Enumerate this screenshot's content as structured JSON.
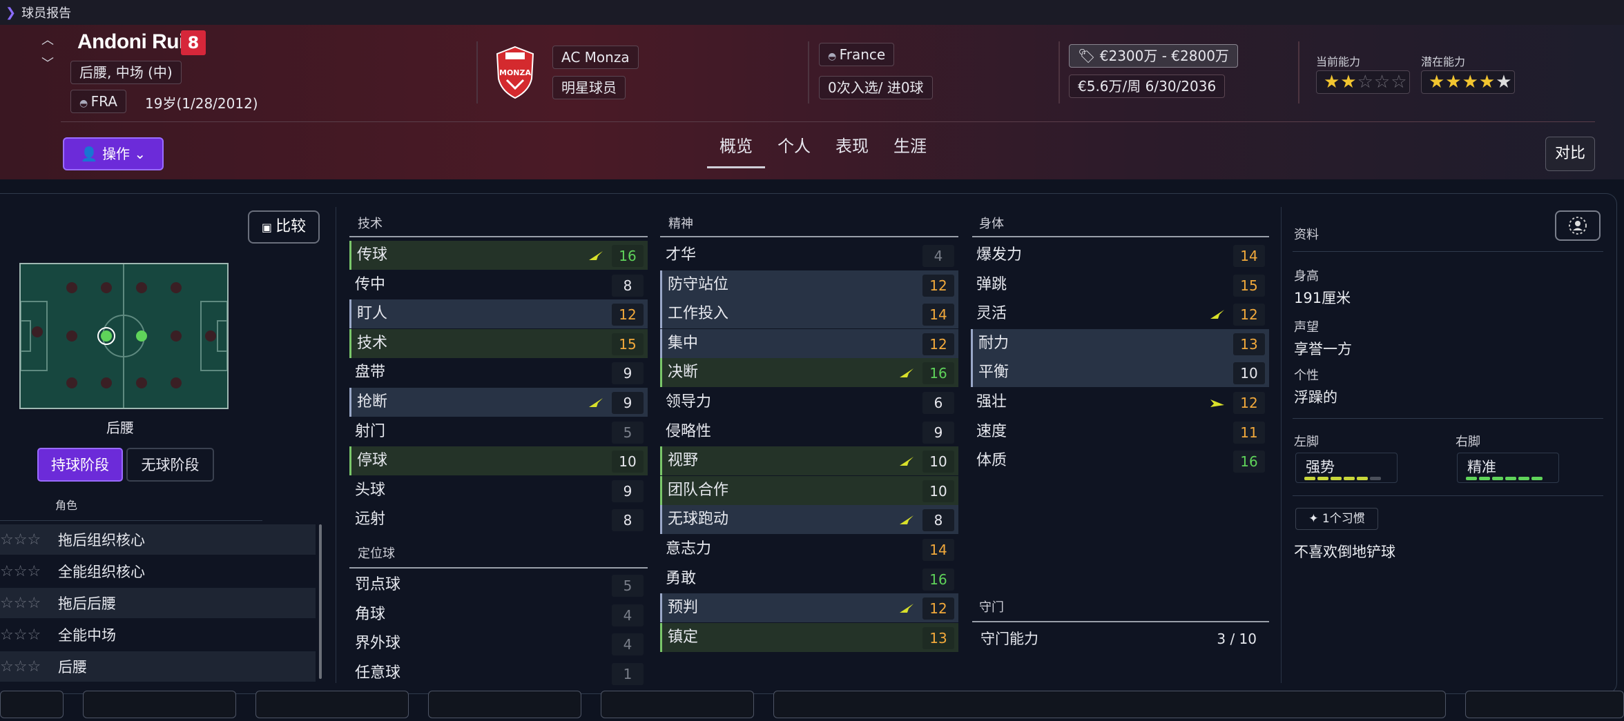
{
  "topbar": {
    "title": "球员报告"
  },
  "player": {
    "name": "Andoni Ruiz",
    "number": "8",
    "positions": "后腰, 中场 (中)",
    "nationality_code": "FRA",
    "age_dob": "19岁(1/28/2012)",
    "club": "AC Monza",
    "club_status": "明星球员",
    "country": "France",
    "caps": "0次入选/ 进0球",
    "value": "€2300万 - €2800万",
    "wage": "€5.6万/周 6/30/2036",
    "ca_label": "当前能力",
    "pa_label": "潜在能力",
    "ca_stars": 2,
    "pa_stars": 4.5
  },
  "actions": {
    "operate_label": "操作",
    "compare_label": "对比",
    "compare_small_label": "比较"
  },
  "tabs": [
    "概览",
    "个人",
    "表现",
    "生涯"
  ],
  "position_panel": {
    "position_name": "后腰",
    "phase_in": "持球阶段",
    "phase_out": "无球阶段",
    "roles_label": "角色"
  },
  "roles": [
    {
      "name": "拖后组织核心",
      "stars": "☆☆☆"
    },
    {
      "name": "全能组织核心",
      "stars": "☆☆☆"
    },
    {
      "name": "拖后后腰",
      "stars": "☆☆☆"
    },
    {
      "name": "全能中场",
      "stars": "☆☆☆"
    },
    {
      "name": "后腰",
      "stars": "☆☆☆"
    }
  ],
  "technical": {
    "title": "技术",
    "rows": [
      {
        "name": "传球",
        "value": "16",
        "style": "gr",
        "arrow": "up",
        "color": "#5fd35a"
      },
      {
        "name": "传中",
        "value": "8",
        "style": "",
        "arrow": "",
        "color": "#e8e8ee"
      },
      {
        "name": "盯人",
        "value": "12",
        "style": "hl",
        "arrow": "",
        "color": "#f2a93b"
      },
      {
        "name": "技术",
        "value": "15",
        "style": "gr",
        "arrow": "",
        "color": "#f2a93b"
      },
      {
        "name": "盘带",
        "value": "9",
        "style": "",
        "arrow": "",
        "color": "#e8e8ee"
      },
      {
        "name": "抢断",
        "value": "9",
        "style": "hl",
        "arrow": "up",
        "color": "#e8e8ee"
      },
      {
        "name": "射门",
        "value": "5",
        "style": "",
        "arrow": "",
        "color": "#7a7f8a"
      },
      {
        "name": "停球",
        "value": "10",
        "style": "gr",
        "arrow": "",
        "color": "#e8e8ee"
      },
      {
        "name": "头球",
        "value": "9",
        "style": "",
        "arrow": "",
        "color": "#e8e8ee"
      },
      {
        "name": "远射",
        "value": "8",
        "style": "",
        "arrow": "",
        "color": "#e8e8ee"
      }
    ]
  },
  "set_pieces": {
    "title": "定位球",
    "rows": [
      {
        "name": "罚点球",
        "value": "5",
        "style": "",
        "arrow": "",
        "color": "#7a7f8a"
      },
      {
        "name": "角球",
        "value": "4",
        "style": "",
        "arrow": "",
        "color": "#7a7f8a"
      },
      {
        "name": "界外球",
        "value": "4",
        "style": "",
        "arrow": "",
        "color": "#7a7f8a"
      },
      {
        "name": "任意球",
        "value": "1",
        "style": "",
        "arrow": "",
        "color": "#7a7f8a"
      }
    ]
  },
  "mental": {
    "title": "精神",
    "rows": [
      {
        "name": "才华",
        "value": "4",
        "style": "",
        "arrow": "",
        "color": "#7a7f8a"
      },
      {
        "name": "防守站位",
        "value": "12",
        "style": "hl",
        "arrow": "",
        "color": "#f2a93b"
      },
      {
        "name": "工作投入",
        "value": "14",
        "style": "hl",
        "arrow": "",
        "color": "#f2a93b"
      },
      {
        "name": "集中",
        "value": "12",
        "style": "hl",
        "arrow": "",
        "color": "#f2a93b"
      },
      {
        "name": "决断",
        "value": "16",
        "style": "gr",
        "arrow": "up",
        "color": "#5fd35a"
      },
      {
        "name": "领导力",
        "value": "6",
        "style": "",
        "arrow": "",
        "color": "#e8e8ee"
      },
      {
        "name": "侵略性",
        "value": "9",
        "style": "",
        "arrow": "",
        "color": "#e8e8ee"
      },
      {
        "name": "视野",
        "value": "10",
        "style": "gr",
        "arrow": "up",
        "color": "#e8e8ee"
      },
      {
        "name": "团队合作",
        "value": "10",
        "style": "gr",
        "arrow": "",
        "color": "#e8e8ee"
      },
      {
        "name": "无球跑动",
        "value": "8",
        "style": "hl",
        "arrow": "up",
        "color": "#e8e8ee"
      },
      {
        "name": "意志力",
        "value": "14",
        "style": "",
        "arrow": "",
        "color": "#f2a93b"
      },
      {
        "name": "勇敢",
        "value": "16",
        "style": "",
        "arrow": "",
        "color": "#5fd35a"
      },
      {
        "name": "预判",
        "value": "12",
        "style": "hl",
        "arrow": "up",
        "color": "#f2a93b"
      },
      {
        "name": "镇定",
        "value": "13",
        "style": "gr",
        "arrow": "",
        "color": "#f2a93b"
      }
    ]
  },
  "physical": {
    "title": "身体",
    "rows": [
      {
        "name": "爆发力",
        "value": "14",
        "style": "",
        "arrow": "",
        "color": "#f2a93b"
      },
      {
        "name": "弹跳",
        "value": "15",
        "style": "",
        "arrow": "",
        "color": "#f2a93b"
      },
      {
        "name": "灵活",
        "value": "12",
        "style": "",
        "arrow": "up",
        "color": "#f2a93b"
      },
      {
        "name": "耐力",
        "value": "13",
        "style": "hl",
        "arrow": "",
        "color": "#f2a93b"
      },
      {
        "name": "平衡",
        "value": "10",
        "style": "hl",
        "arrow": "",
        "color": "#e8e8ee"
      },
      {
        "name": "强壮",
        "value": "12",
        "style": "",
        "arrow": "right",
        "color": "#f2a93b"
      },
      {
        "name": "速度",
        "value": "11",
        "style": "",
        "arrow": "",
        "color": "#f2a93b"
      },
      {
        "name": "体质",
        "value": "16",
        "style": "",
        "arrow": "",
        "color": "#5fd35a"
      }
    ]
  },
  "goalkeeping": {
    "title": "守门",
    "label": "守门能力",
    "value": "3 / 10"
  },
  "info": {
    "title": "资料",
    "height_label": "身高",
    "height": "191厘米",
    "rep_label": "声望",
    "reputation": "享誉一方",
    "pers_label": "个性",
    "personality": "浮躁的",
    "left_foot_label": "左脚",
    "left_foot": "强势",
    "right_foot_label": "右脚",
    "right_foot": "精准",
    "habits_label": "1个习惯",
    "habit": "不喜欢倒地铲球"
  },
  "colors": {
    "accent": "#6c2bd9",
    "good": "#5fd35a",
    "mid": "#f2a93b",
    "low": "#7a7f8a"
  }
}
